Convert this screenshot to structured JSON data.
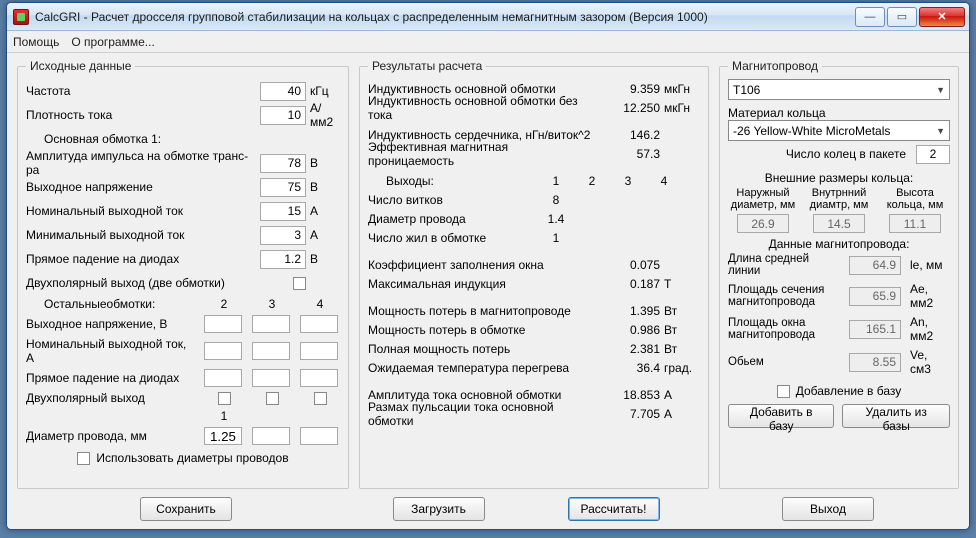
{
  "window": {
    "title": "CalcGRI - Расчет дросселя групповой стабилизации на кольцах с распределенным немагнитным зазором (Версия 1000)"
  },
  "menu": {
    "help": "Помощь",
    "about": "О программе..."
  },
  "inputs": {
    "legend": "Исходные данные",
    "freq_label": "Частота",
    "freq_val": "40",
    "freq_unit": "кГц",
    "jdens_label": "Плотность тока",
    "jdens_val": "10",
    "jdens_unit": "А/мм2",
    "prim_title": "Основная обмотка 1:",
    "amp_label": "Амплитуда импульса на обмотке транс-ра",
    "amp_val": "78",
    "amp_unit": "В",
    "vout_label": "Выходное напряжение",
    "vout_val": "75",
    "vout_unit": "В",
    "inom_label": "Номинальный выходной ток",
    "inom_val": "15",
    "inom_unit": "А",
    "imin_label": "Минимальный выходной ток",
    "imin_val": "3",
    "imin_unit": "А",
    "vdio_label": "Прямое падение на диодах",
    "vdio_val": "1.2",
    "vdio_unit": "В",
    "bipolar_label": "Двухполярный выход (две обмотки)",
    "others_title": "Остальныеобмотки:",
    "cols": {
      "c2": "2",
      "c3": "3",
      "c4": "4"
    },
    "ovout_label": "Выходное напряжение, В",
    "oinom_label": "Номинальный выходной ток, А",
    "ovdio_label": "Прямое падение на диодах",
    "obip_label": "Двухполярный выход",
    "wire_row_hdr": "1",
    "wire_label": "Диаметр провода, мм",
    "wire_val": "1.25",
    "usewire_label": "Использовать диаметры проводов"
  },
  "results": {
    "legend": "Результаты расчета",
    "L_main": "Индуктивность основной обмотки",
    "L_main_v": "9.359",
    "L_main_u": "мкГн",
    "L_noI": "Индуктивность основной обмотки без тока",
    "L_noI_v": "12.250",
    "L_noI_u": "мкГн",
    "L_core": "Индуктивность сердечника, нГн/виток^2",
    "L_core_v": "146.2",
    "mu_eff": "Эффективная магнитная проницаемость",
    "mu_eff_v": "57.3",
    "out_hdr": "Выходы:",
    "c1": "1",
    "c2": "2",
    "c3": "3",
    "c4": "4",
    "turns_l": "Число витков",
    "turns_v": "8",
    "dwire_l": "Диаметр провода",
    "dwire_v": "1.4",
    "strands_l": "Число жил в обмотке",
    "strands_v": "1",
    "kfill_l": "Коэффициент заполнения окна",
    "kfill_v": "0.075",
    "bmax_l": "Максимальная индукция",
    "bmax_v": "0.187",
    "bmax_u": "Т",
    "pcore_l": "Мощность потерь в магнитопроводе",
    "pcore_v": "1.395",
    "pcore_u": "Вт",
    "pwind_l": "Мощность потерь в обмотке",
    "pwind_v": "0.986",
    "pwind_u": "Вт",
    "ptot_l": "Полная мощность потерь",
    "ptot_v": "2.381",
    "ptot_u": "Вт",
    "dtmp_l": "Ожидаемая температура перегрева",
    "dtmp_v": "36.4",
    "dtmp_u": "град.",
    "iamp_l": "Амплитуда тока основной обмотки",
    "iamp_v": "18.853",
    "iamp_u": "А",
    "irip_l": "Размах пульсации тока основной обмотки",
    "irip_v": "7.705",
    "irip_u": "А"
  },
  "core": {
    "legend": "Магнитопровод",
    "core_sel": "T106",
    "mat_label": "Материал кольца",
    "mat_sel": "-26 Yellow-White MicroMetals",
    "stack_label": "Число колец в пакете",
    "stack_val": "2",
    "dims_title": "Внешние размеры кольца:",
    "od_h1": "Наружный",
    "od_h2": "диаметр, мм",
    "od_v": "26.9",
    "id_h1": "Внутрнний",
    "id_h2": "диамтр, мм",
    "id_v": "14.5",
    "ht_h1": "Высота",
    "ht_h2": "кольца, мм",
    "ht_v": "11.1",
    "mag_title": "Данные магнитопровода:",
    "le_l1": "Длина средней",
    "le_l2": "линии",
    "le_v": "64.9",
    "le_u": "le, мм",
    "ae_l1": "Площадь сечения",
    "ae_l2": "магнитопровода",
    "ae_v": "65.9",
    "ae_u": "Ae, мм2",
    "an_l1": "Площадь окна",
    "an_l2": "магнитопровода",
    "an_v": "165.1",
    "an_u": "An, мм2",
    "ve_l": "Обьем",
    "ve_v": "8.55",
    "ve_u": "Ve, см3",
    "adddb_label": "Добавление в базу",
    "btn_add": "Добавить в базу",
    "btn_del": "Удалить из базы"
  },
  "buttons": {
    "save": "Сохранить",
    "load": "Загрузить",
    "calc": "Рассчитать!",
    "exit": "Выход"
  }
}
